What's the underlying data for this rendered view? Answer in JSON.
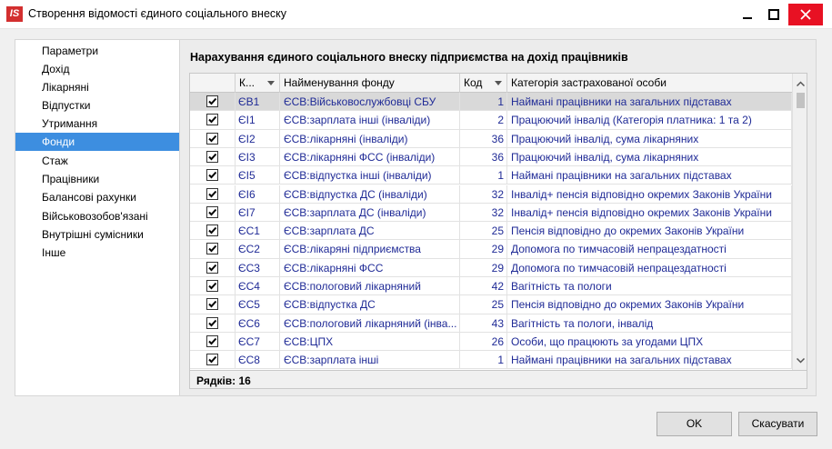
{
  "window": {
    "logo_text": "IS",
    "title": "Створення відомості єдиного соціального внеску"
  },
  "nav": {
    "items": [
      {
        "label": "Параметри"
      },
      {
        "label": "Дохід"
      },
      {
        "label": "Лікарняні"
      },
      {
        "label": "Відпустки"
      },
      {
        "label": "Утримання"
      },
      {
        "label": "Фонди"
      },
      {
        "label": "Стаж"
      },
      {
        "label": "Працівники"
      },
      {
        "label": "Балансові рахунки"
      },
      {
        "label": "Військовозобов'язані"
      },
      {
        "label": "Внутрішні сумісники"
      },
      {
        "label": "Інше"
      }
    ],
    "selected": "Фонди"
  },
  "panel": {
    "title": "Нарахування єдиного соціального внеску підприємства на дохід працівників"
  },
  "grid": {
    "columns": {
      "code": "К...",
      "fund": "Найменування фонду",
      "kod": "Код",
      "category": "Категорія застрахованої особи"
    },
    "rows": [
      {
        "checked": true,
        "code": "ЄВ1",
        "fund": "ЄСВ:Військовослужбовці СБУ",
        "kod": "1",
        "category": "Наймані працівники на загальних підставах"
      },
      {
        "checked": true,
        "code": "ЄІ1",
        "fund": "ЄСВ:зарплата інші (інваліди)",
        "kod": "2",
        "category": "Працюючий інвалід (Категорія платника: 1 та 2)"
      },
      {
        "checked": true,
        "code": "ЄІ2",
        "fund": "ЄСВ:лікарняні (інваліди)",
        "kod": "36",
        "category": "Працюючий інвалід, сума лікарняних"
      },
      {
        "checked": true,
        "code": "ЄІ3",
        "fund": "ЄСВ:лікарняні ФСС (інваліди)",
        "kod": "36",
        "category": "Працюючий інвалід, сума лікарняних"
      },
      {
        "checked": true,
        "code": "ЄІ5",
        "fund": "ЄСВ:відпустка інші (інваліди)",
        "kod": "1",
        "category": "Наймані працівники на загальних підставах"
      },
      {
        "checked": true,
        "code": "ЄІ6",
        "fund": "ЄСВ:відпустка ДС (інваліди)",
        "kod": "32",
        "category": "Інвалід+ пенсія відповідно окремих Законів України"
      },
      {
        "checked": true,
        "code": "ЄІ7",
        "fund": "ЄСВ:зарплата ДС (інваліди)",
        "kod": "32",
        "category": "Інвалід+ пенсія відповідно окремих Законів України"
      },
      {
        "checked": true,
        "code": "ЄС1",
        "fund": "ЄСВ:зарплата ДС",
        "kod": "25",
        "category": "Пенсія відповідно до окремих  Законів України"
      },
      {
        "checked": true,
        "code": "ЄС2",
        "fund": "ЄСВ:лікаряні підприємства",
        "kod": "29",
        "category": "Допомога по тимчасовій непрацездатності"
      },
      {
        "checked": true,
        "code": "ЄС3",
        "fund": "ЄСВ:лікарняні ФСС",
        "kod": "29",
        "category": "Допомога по тимчасовій непрацездатності"
      },
      {
        "checked": true,
        "code": "ЄС4",
        "fund": "ЄСВ:пологовий лікарняний",
        "kod": "42",
        "category": "Вагітність та пологи"
      },
      {
        "checked": true,
        "code": "ЄС5",
        "fund": "ЄСВ:відпустка ДС",
        "kod": "25",
        "category": "Пенсія відповідно до окремих  Законів України"
      },
      {
        "checked": true,
        "code": "ЄС6",
        "fund": "ЄСВ:пологовий лікарняний (інва...",
        "kod": "43",
        "category": "Вагітність та пологи, інвалід"
      },
      {
        "checked": true,
        "code": "ЄС7",
        "fund": "ЄСВ:ЦПХ",
        "kod": "26",
        "category": "Особи, що працюють за угодами ЦПХ"
      },
      {
        "checked": true,
        "code": "ЄС8",
        "fund": "ЄСВ:зарплата інші",
        "kod": "1",
        "category": "Наймані працівники на загальних підставах"
      }
    ],
    "footer": "Рядків: 16"
  },
  "buttons": {
    "ok": "OK",
    "cancel": "Скасувати"
  }
}
